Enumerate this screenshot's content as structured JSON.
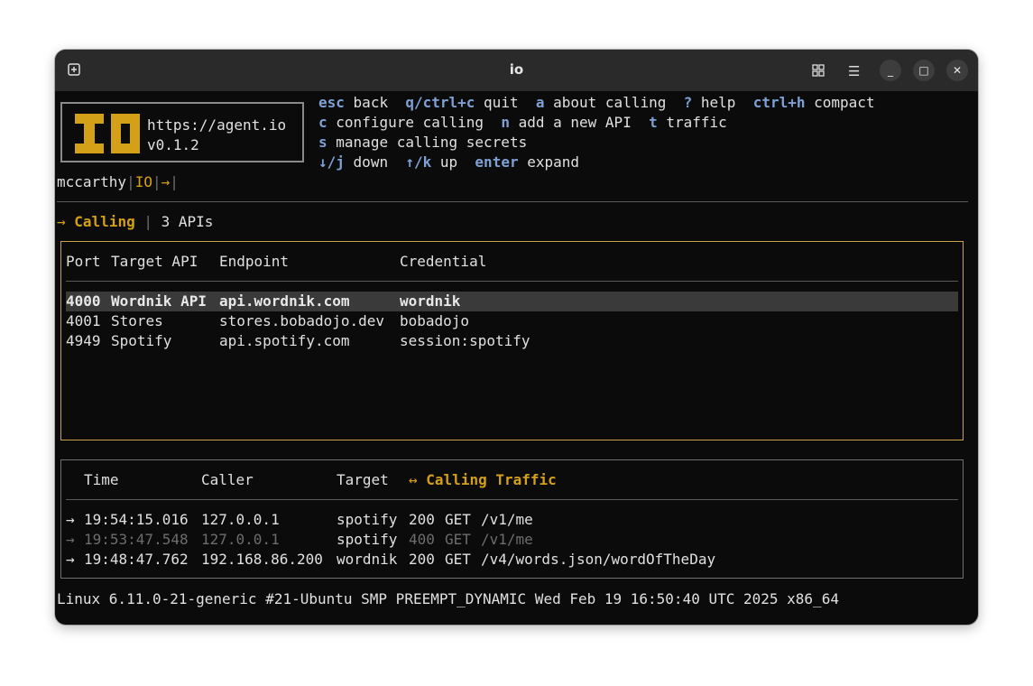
{
  "window": {
    "title": "io"
  },
  "header": {
    "url": "https://agent.io",
    "version": "v0.1.2",
    "breadcrumb": {
      "user": "mccarthy",
      "sep1": "|",
      "app": "IO",
      "sep2": "|",
      "arrow": "→",
      "sep3": "|"
    },
    "shortcuts": [
      [
        {
          "key": "esc",
          "label": "back"
        },
        {
          "key": "q/ctrl+c",
          "label": "quit"
        },
        {
          "key": "a",
          "label": "about calling"
        },
        {
          "key": "?",
          "label": "help"
        },
        {
          "key": "ctrl+h",
          "label": "compact"
        }
      ],
      [
        {
          "key": "c",
          "label": "configure calling"
        },
        {
          "key": "n",
          "label": "add a new API"
        },
        {
          "key": "t",
          "label": "traffic"
        }
      ],
      [
        {
          "key": "s",
          "label": "manage calling secrets"
        }
      ],
      [
        {
          "key": "↓/j",
          "label": "down"
        },
        {
          "key": "↑/k",
          "label": "up"
        },
        {
          "key": "enter",
          "label": "expand"
        }
      ]
    ]
  },
  "section": {
    "arrow": "→",
    "title": "Calling",
    "sep": "|",
    "count": "3 APIs"
  },
  "apis_table": {
    "headers": [
      "Port",
      "Target API",
      "Endpoint",
      "Credential"
    ],
    "rows": [
      [
        "4000",
        "Wordnik API",
        "api.wordnik.com",
        "wordnik"
      ],
      [
        "4001",
        "Stores",
        "stores.bobadojo.dev",
        "bobadojo"
      ],
      [
        "4949",
        "Spotify",
        "api.spotify.com",
        "session:spotify"
      ]
    ],
    "selected_row": 0
  },
  "traffic_table": {
    "headers": [
      "Time",
      "Caller",
      "Target"
    ],
    "title_icon": "↔",
    "title": "Calling Traffic",
    "rows": [
      {
        "arrow": "→",
        "time": "19:54:15.016",
        "caller": "127.0.0.1",
        "target": "spotify",
        "status": "200",
        "method": "GET",
        "path": "/v1/me",
        "dim": false
      },
      {
        "arrow": "→",
        "time": "19:53:47.548",
        "caller": "127.0.0.1",
        "target": "spotify",
        "status": "400",
        "method": "GET",
        "path": "/v1/me",
        "dim": true
      },
      {
        "arrow": "→",
        "time": "19:48:47.762",
        "caller": "192.168.86.200",
        "target": "wordnik",
        "status": "200",
        "method": "GET",
        "path": "/v4/words.json/wordOfTheDay",
        "dim": false
      }
    ]
  },
  "status_line": "Linux 6.11.0-21-generic #21-Ubuntu SMP PREEMPT_DYNAMIC Wed Feb 19 16:50:40 UTC 2025 x86_64",
  "colors": {
    "accent": "#d4a017",
    "key": "#7fa0d4",
    "background": "#0b0b0b",
    "selected_row": "#3a3a3a"
  }
}
